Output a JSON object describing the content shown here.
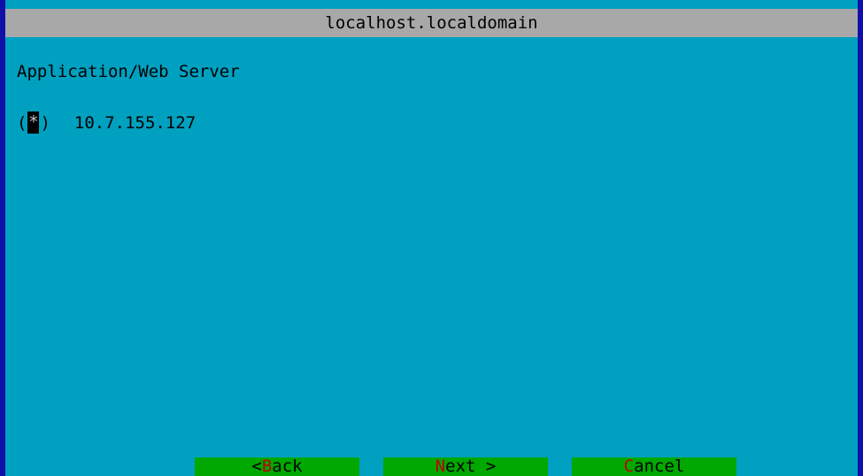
{
  "window": {
    "title": "localhost.localdomain"
  },
  "section": {
    "label": "Application/Web Server"
  },
  "radio": {
    "open": "(",
    "mark": "*",
    "close": ")",
    "value": "10.7.155.127",
    "selected": true
  },
  "buttons": {
    "back": {
      "prefix": "< ",
      "hotkey": "B",
      "rest": "ack"
    },
    "next": {
      "hotkey": "N",
      "rest": "ext >"
    },
    "cancel": {
      "hotkey": "C",
      "rest": "ancel"
    }
  },
  "colors": {
    "desktop": "#1010a8",
    "dialog": "#00a0c0",
    "titlebar": "#a8a8a8",
    "button": "#00a800",
    "hotkey": "#c00000"
  }
}
